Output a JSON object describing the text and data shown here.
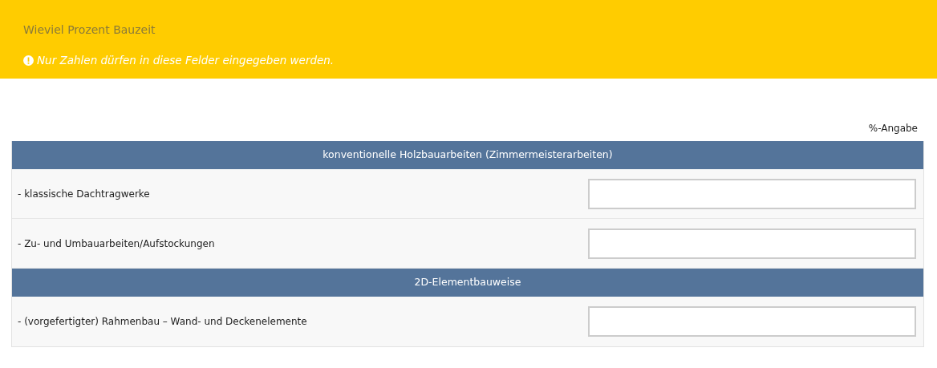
{
  "header": {
    "title": "Wieviel Prozent Bauzeit",
    "notice": "Nur Zahlen dürfen in diese Felder eingegeben werden."
  },
  "column_label": "%-Angabe",
  "rows": [
    {
      "kind": "section",
      "label": "konventionelle Holzbauarbeiten (Zimmermeisterarbeiten)"
    },
    {
      "kind": "question",
      "label": "- klassische Dachtragwerke"
    },
    {
      "kind": "question",
      "label": "- Zu- und Umbauarbeiten/Aufstockungen"
    },
    {
      "kind": "section",
      "label": "2D-Elementbauweise"
    },
    {
      "kind": "question",
      "label": "- (vorgefertigter) Rahmenbau – Wand- und Deckenelemente"
    }
  ]
}
